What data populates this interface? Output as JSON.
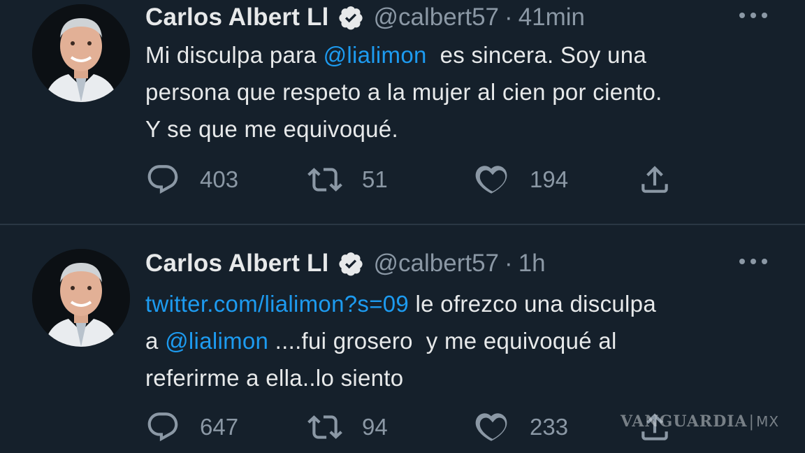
{
  "tweets": [
    {
      "author": "Carlos Albert Ll",
      "handle": "@calbert57",
      "separator": "·",
      "time": "41min",
      "text_parts": {
        "line1_pre": "Mi disculpa para ",
        "line1_mention": "@lialimon",
        "line1_post": "  es sincera. Soy una",
        "line2": "persona que respeto a la mujer al cien por ciento.",
        "line3": "Y se que me equivoqué."
      },
      "replies": "403",
      "retweets": "51",
      "likes": "194"
    },
    {
      "author": "Carlos Albert Ll",
      "handle": "@calbert57",
      "separator": "·",
      "time": "1h",
      "text_parts": {
        "line1_link": "twitter.com/lialimon?s=09",
        "line1_post": " le ofrezco una disculpa",
        "line2_pre": "a ",
        "line2_mention": "@lialimon",
        "line2_post": " ....fui grosero  y me equivoqué al",
        "line3": "referirme a ella..lo siento"
      },
      "replies": "647",
      "retweets": "94",
      "likes": "233"
    }
  ],
  "icons": {
    "verified": "verified-badge-icon",
    "more": "more-dots-icon",
    "reply": "reply-bubble-icon",
    "retweet": "retweet-icon",
    "like": "heart-icon",
    "share": "share-upload-icon"
  },
  "watermark": {
    "brand": "VANGUARDIA",
    "separator": "|",
    "country": "MX"
  },
  "colors": {
    "background": "#15202b",
    "text": "#e7e9ea",
    "muted": "#8b98a5",
    "accent": "#1d9bf0"
  }
}
